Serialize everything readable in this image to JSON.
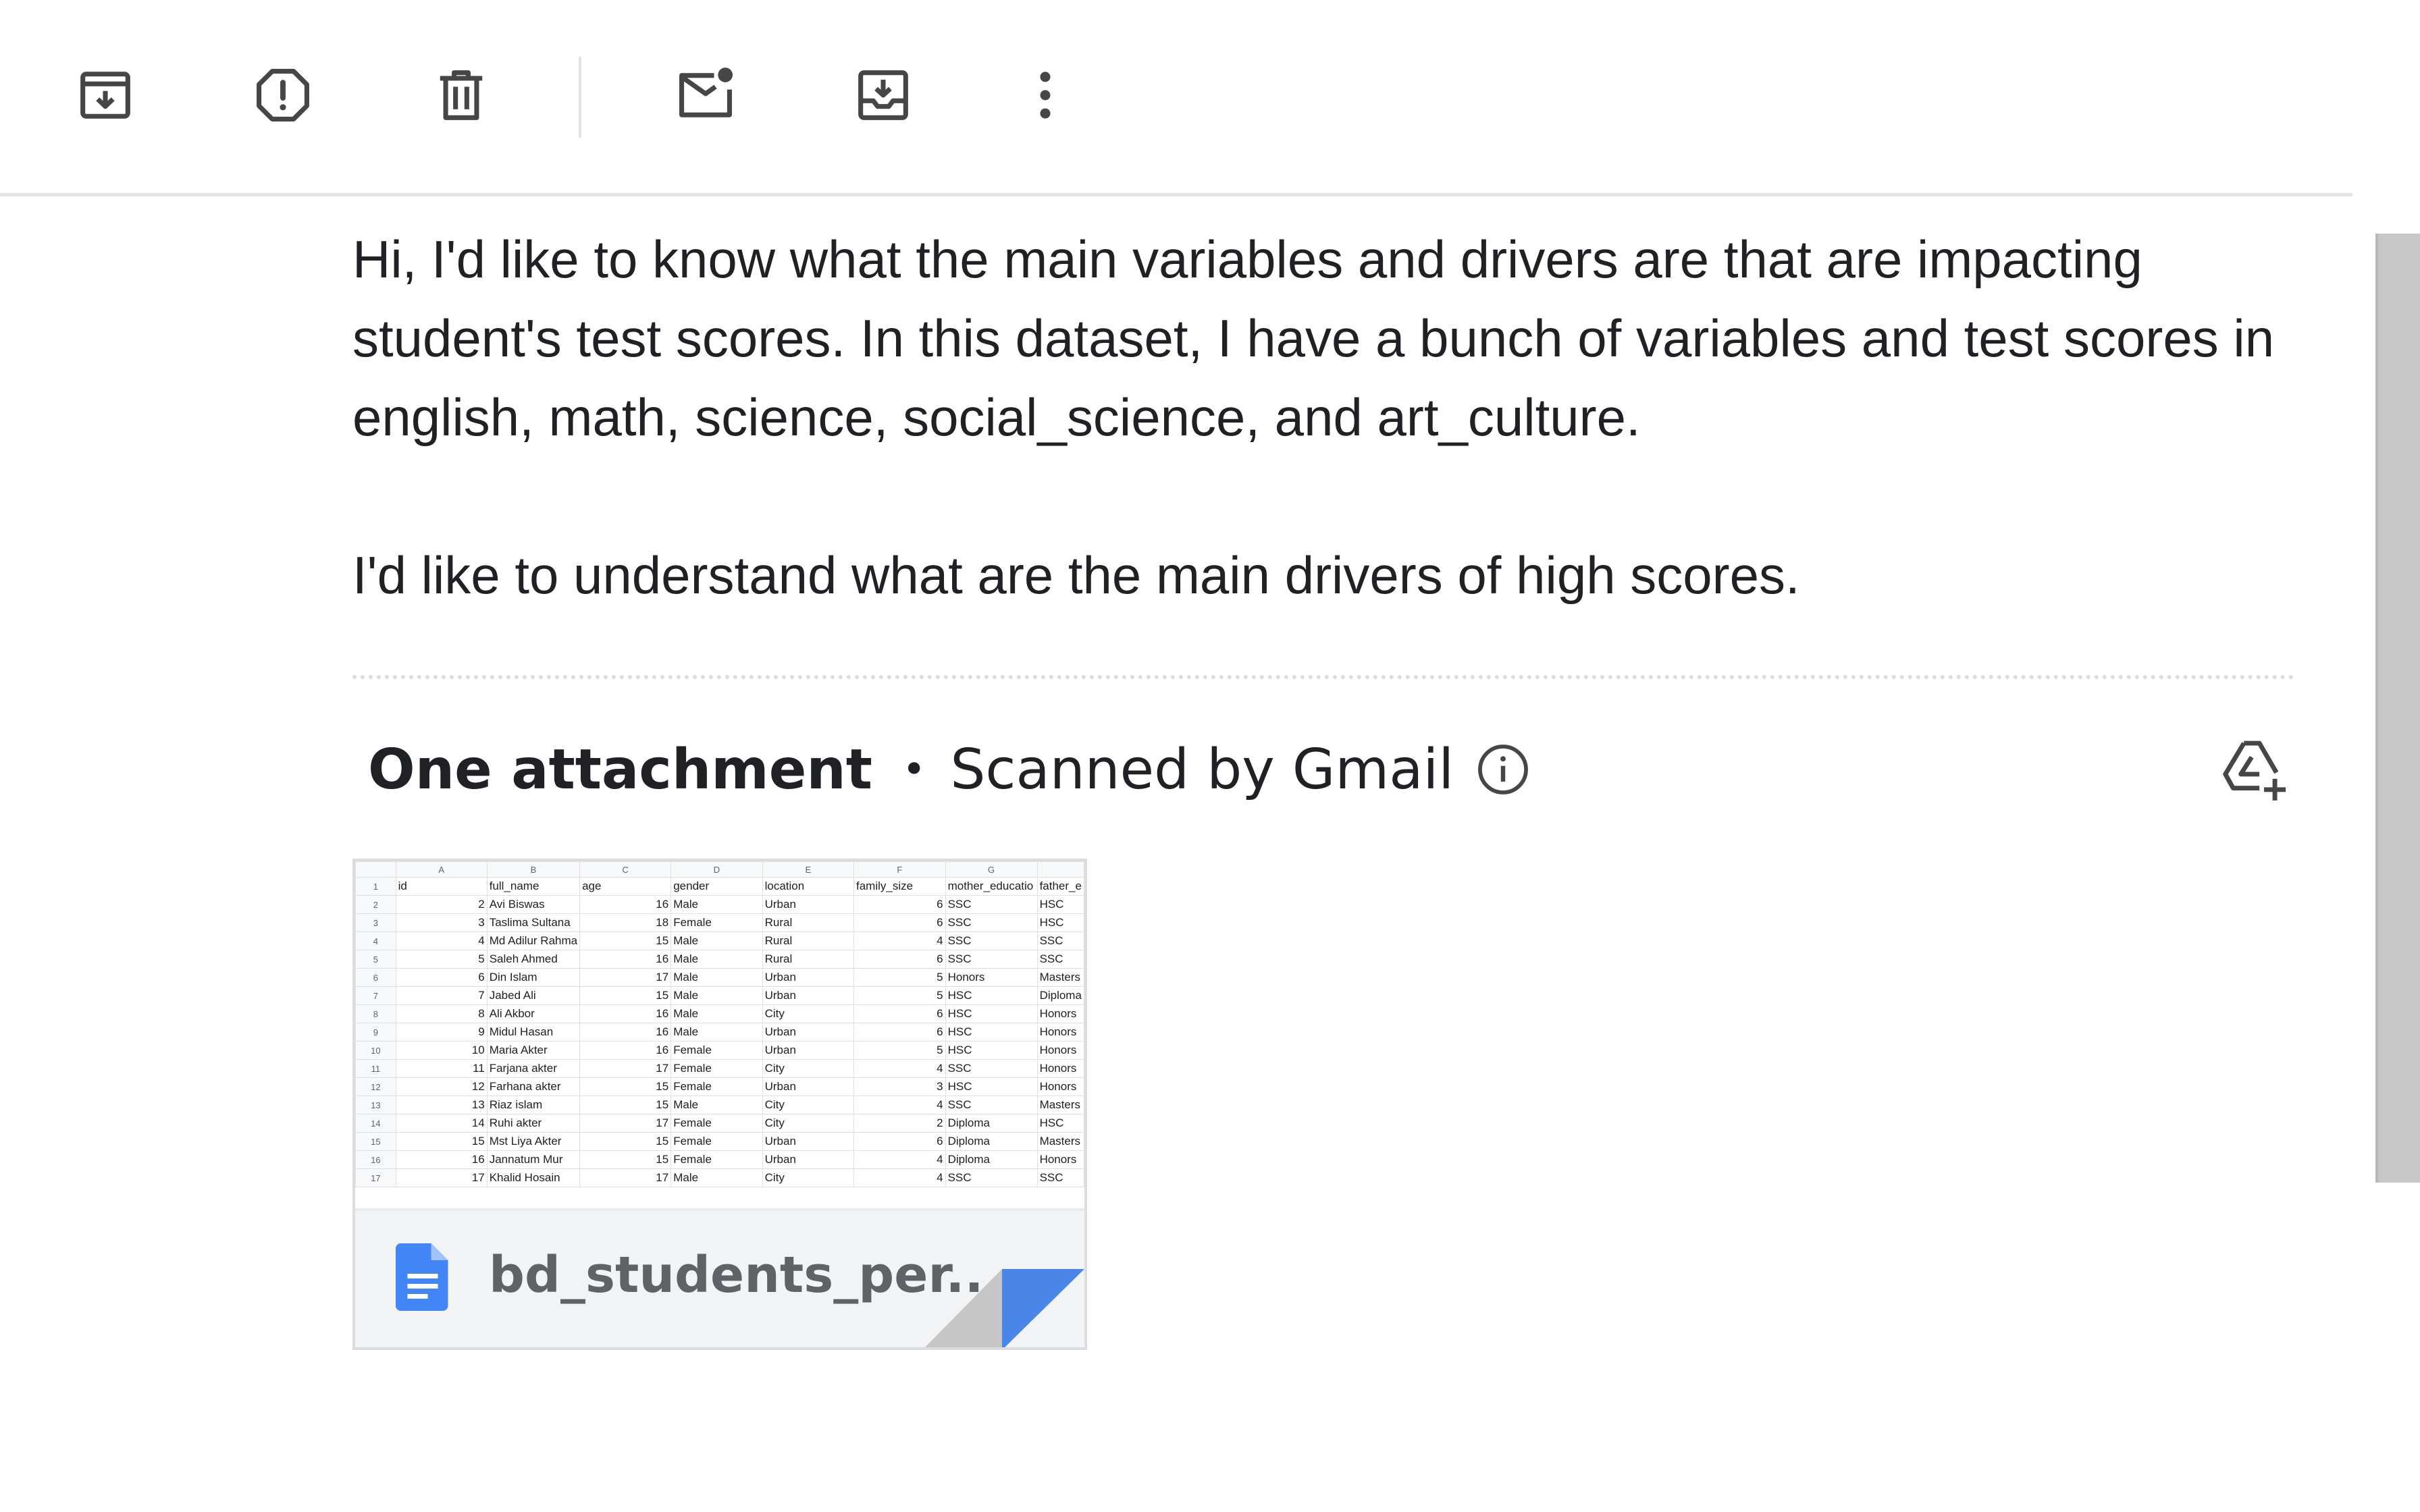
{
  "toolbar": {
    "buttons": [
      {
        "name": "archive",
        "icon": "archive-icon"
      },
      {
        "name": "report-spam",
        "icon": "report-spam-icon"
      },
      {
        "name": "delete",
        "icon": "trash-icon"
      },
      {
        "name": "mark-unread",
        "icon": "mark-unread-icon"
      },
      {
        "name": "move-to",
        "icon": "move-to-inbox-icon"
      },
      {
        "name": "more",
        "icon": "more-vert-icon"
      }
    ]
  },
  "message": {
    "paragraph1": "Hi, I'd like to know what the main variables and drivers are that are impacting student's test scores. In this dataset, I have a bunch of variables and test scores in english, math, science, social_science, and art_culture.",
    "paragraph2": "I'd like to understand what are the main drivers of high scores."
  },
  "attachments": {
    "title": "One attachment",
    "separator": "•",
    "scan_note": "Scanned by Gmail",
    "file": {
      "name": "bd_students_per....",
      "icon": "google-docs-icon",
      "accent": "#4285f4"
    },
    "preview": {
      "col_letters": [
        "A",
        "B",
        "C",
        "D",
        "E",
        "F",
        "G",
        ""
      ],
      "headers": [
        "id",
        "full_name",
        "age",
        "gender",
        "location",
        "family_size",
        "mother_educatio",
        "father_e"
      ],
      "rows": [
        [
          "2",
          "Avi Biswas",
          "16",
          "Male",
          "Urban",
          "6",
          "SSC",
          "HSC"
        ],
        [
          "3",
          "Taslima Sultana",
          "18",
          "Female",
          "Rural",
          "6",
          "SSC",
          "HSC"
        ],
        [
          "4",
          "Md Adilur Rahma",
          "15",
          "Male",
          "Rural",
          "4",
          "SSC",
          "SSC"
        ],
        [
          "5",
          "Saleh Ahmed",
          "16",
          "Male",
          "Rural",
          "6",
          "SSC",
          "SSC"
        ],
        [
          "6",
          "Din Islam",
          "17",
          "Male",
          "Urban",
          "5",
          "Honors",
          "Masters"
        ],
        [
          "7",
          "Jabed Ali",
          "15",
          "Male",
          "Urban",
          "5",
          "HSC",
          "Diploma"
        ],
        [
          "8",
          "Ali Akbor",
          "16",
          "Male",
          "City",
          "6",
          "HSC",
          "Honors"
        ],
        [
          "9",
          "Midul Hasan",
          "16",
          "Male",
          "Urban",
          "6",
          "HSC",
          "Honors"
        ],
        [
          "10",
          "Maria Akter",
          "16",
          "Female",
          "Urban",
          "5",
          "HSC",
          "Honors"
        ],
        [
          "11",
          "Farjana akter",
          "17",
          "Female",
          "City",
          "4",
          "SSC",
          "Honors"
        ],
        [
          "12",
          "Farhana akter",
          "15",
          "Female",
          "Urban",
          "3",
          "HSC",
          "Honors"
        ],
        [
          "13",
          "Riaz islam",
          "15",
          "Male",
          "City",
          "4",
          "SSC",
          "Masters"
        ],
        [
          "14",
          "Ruhi akter",
          "17",
          "Female",
          "City",
          "2",
          "Diploma",
          "HSC"
        ],
        [
          "15",
          "Mst Liya Akter",
          "15",
          "Female",
          "Urban",
          "6",
          "Diploma",
          "Masters"
        ],
        [
          "16",
          "Jannatum Mur",
          "15",
          "Female",
          "Urban",
          "4",
          "Diploma",
          "Honors"
        ],
        [
          "17",
          "Khalid Hosain",
          "17",
          "Male",
          "City",
          "4",
          "SSC",
          "SSC"
        ]
      ]
    }
  },
  "colors": {
    "icon_gray": "#444746",
    "text": "#202124",
    "muted": "#5f6368",
    "doc_blue": "#4285f4"
  }
}
